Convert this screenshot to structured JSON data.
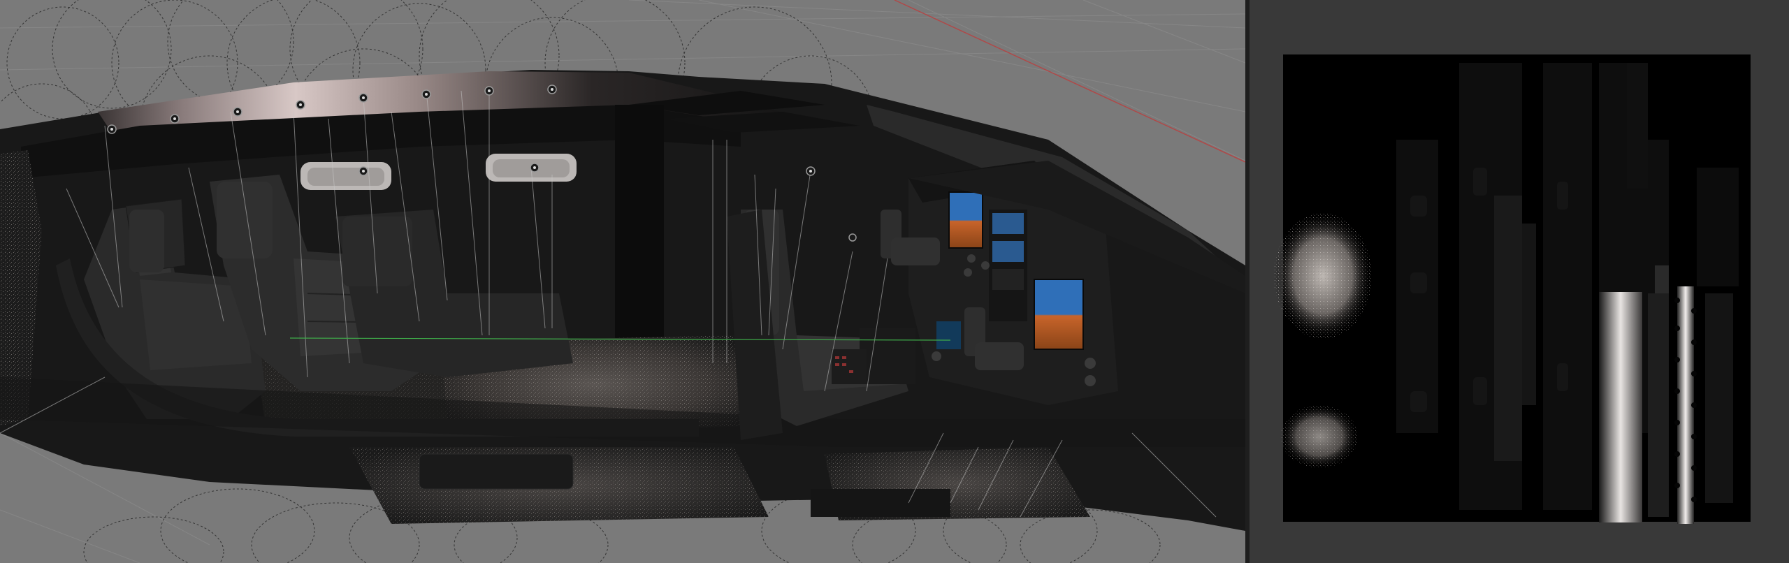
{
  "app": {
    "viewport": {
      "name": "3d-viewport",
      "object": "aircraft-cabin-model",
      "display": "lightmap-bake-preview"
    },
    "image_editor": {
      "name": "image-editor",
      "content": "baked-lightmap-texture"
    }
  },
  "colors": {
    "viewport_bg": "#7a7a7a",
    "grid_line": "#8a8a8a",
    "x_axis": "#b04848",
    "y_axis": "#3fae4a",
    "model_dark": "#141414",
    "model_mid": "#262626",
    "panel_bg": "#393939",
    "texture_bg": "#000000",
    "screen_blue": "#2f6fb8",
    "screen_orange": "#c8642a",
    "light_gizmo": "#1a1a1a"
  },
  "icons": {
    "light_gizmo": "point-light-icon",
    "seat": "seat-shape",
    "screen": "pfd-screen-shape"
  }
}
